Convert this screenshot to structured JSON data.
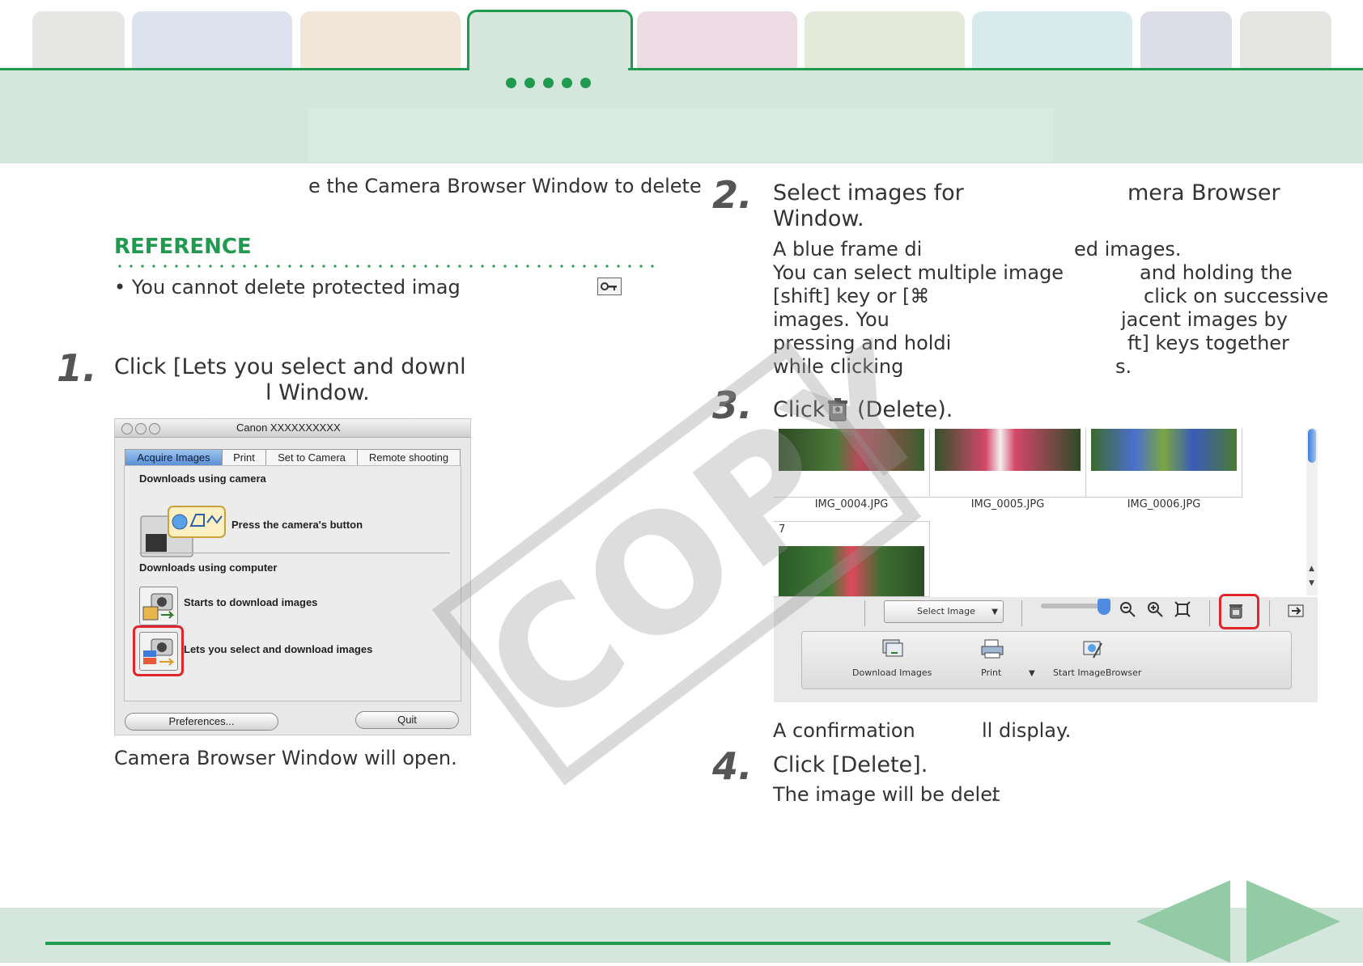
{
  "header": {
    "tab_colors": [
      "#e6e6e4",
      "#dce3ee",
      "#f1e6d8",
      "#d5e6dc",
      "#ecdbe2",
      "#e3eada",
      "#d7eaec",
      "#dcdde8",
      "#e4e4e2"
    ],
    "accent": "#1f9a4e",
    "page_dots": 5
  },
  "intro": {
    "text": "e the Camera Browser Window to delete"
  },
  "reference": {
    "title": "REFERENCE",
    "bullet": "• You cannot delete protected imag"
  },
  "steps": {
    "s1": {
      "num": "1.",
      "title_line1": "Click [Lets you select and downl",
      "title_line2": "l Window.",
      "result": "Camera Browser Window will open."
    },
    "s2": {
      "num": "2.",
      "title_line1a": "Select images for",
      "title_line1b": "mera Browser",
      "title_line2": "Window.",
      "lines": [
        [
          "A blue frame di",
          "ed images."
        ],
        [
          "You can select multiple image",
          "and holding the"
        ],
        [
          "[shift] key or [⌘",
          "click on successive"
        ],
        [
          "images. You",
          "jacent images by"
        ],
        [
          "pressing and holdi",
          "ft] keys together"
        ],
        [
          "while clicking",
          "s."
        ]
      ]
    },
    "s3": {
      "num": "3.",
      "title_a": "Click",
      "title_b": "(Delete).",
      "confirm_a": "A confirmation",
      "confirm_b": "ll display."
    },
    "s4": {
      "num": "4.",
      "title": "Click [Delete].",
      "result_a": "The image will be delet",
      "result_b": "."
    }
  },
  "dialog": {
    "title": "Canon XXXXXXXXXX",
    "tabs": [
      "Acquire Images",
      "Print",
      "Set to Camera",
      "Remote shooting"
    ],
    "section1": "Downloads using camera",
    "camera_button_text": "Press the camera's button",
    "section2": "Downloads using computer",
    "opt1": "Starts to download images",
    "opt2": "Lets you select and download images",
    "preferences": "Preferences...",
    "quit": "Quit"
  },
  "browser": {
    "files": [
      "IMG_0004.JPG",
      "IMG_0005.JPG",
      "IMG_0006.JPG"
    ],
    "next_index": "7",
    "select_image": "Select Image",
    "buttons": [
      "Download Images",
      "Print",
      "Start ImageBrowser"
    ]
  },
  "watermark": "COPY"
}
